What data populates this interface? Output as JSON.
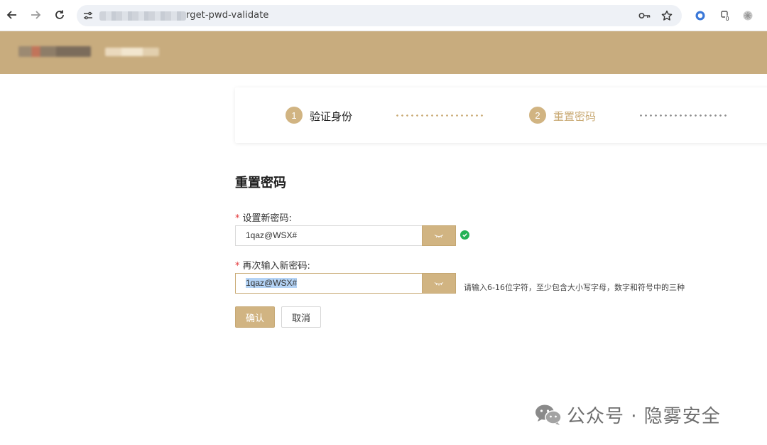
{
  "browser": {
    "url_visible": "rget-pwd-validate",
    "extension_badge": "0"
  },
  "steps": [
    {
      "number": "1",
      "label": "验证身份"
    },
    {
      "number": "2",
      "label": "重置密码"
    }
  ],
  "form": {
    "heading": "重置密码",
    "required_mark": "*",
    "new_password_label": "设置新密码:",
    "new_password_value": "1qaz@WSX#",
    "confirm_password_label": "再次输入新密码:",
    "confirm_password_value": "1qaz@WSX#",
    "hint": "请输入6-16位字符，至少包含大小写字母，数字和符号中的三种",
    "confirm_button": "确认",
    "cancel_button": "取消"
  },
  "watermark": {
    "text": "公众号 · 隐雾安全"
  },
  "colors": {
    "header": "#c8ac7e",
    "accent": "#d1b482",
    "success": "#25b256",
    "step_done_text": "#1f1f1f",
    "step_current_text": "#c9aa74"
  }
}
